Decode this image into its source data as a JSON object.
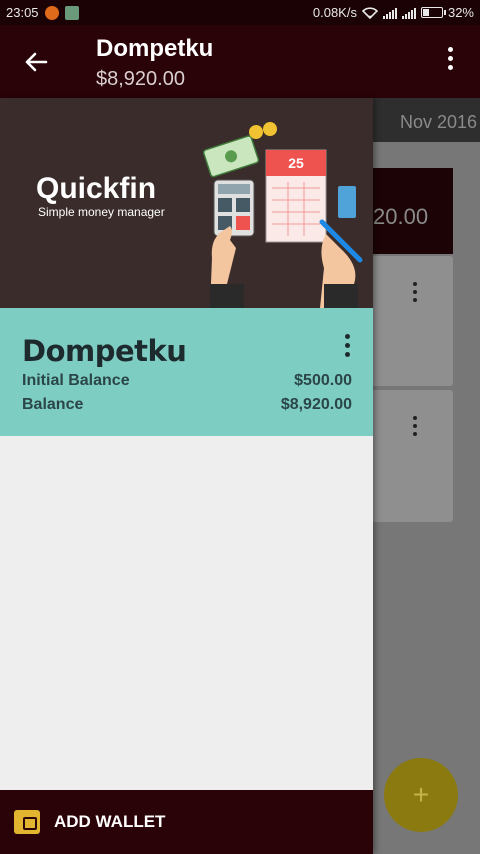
{
  "status_bar": {
    "time": "23:05",
    "network_speed": "0.08K/s",
    "battery": "32%"
  },
  "toolbar": {
    "title": "Dompetku",
    "subtitle": "$8,920.00",
    "back_icon": "arrow-left-icon",
    "more_icon": "more-vert-icon"
  },
  "background": {
    "tab_month": "Nov 2016",
    "card_amount": "20.00"
  },
  "drawer": {
    "brand": "Quickfin",
    "tagline": "Simple money manager",
    "calendar_day": "25",
    "wallet": {
      "name": "Dompetku",
      "initial_balance_label": "Initial Balance",
      "initial_balance_value": "$500.00",
      "balance_label": "Balance",
      "balance_value": "$8,920.00"
    },
    "add_wallet_label": "ADD WALLET"
  },
  "fab": {
    "label": "+"
  },
  "colors": {
    "primary_dark": "#2a0308",
    "wallet_card": "#7ecdc3",
    "accent": "#e2b531"
  }
}
